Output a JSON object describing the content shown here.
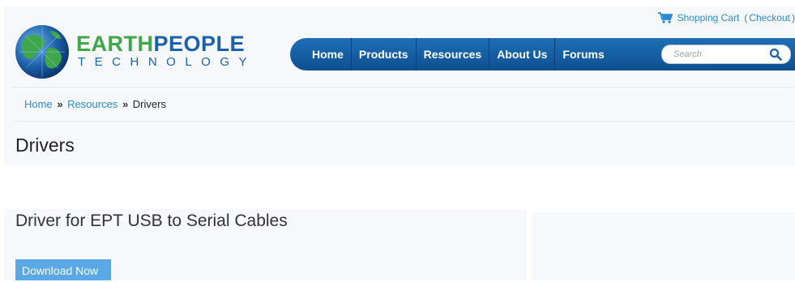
{
  "cart": {
    "shopping_cart_label": "Shopping Cart",
    "open_paren": "(",
    "checkout_label": "Checkout",
    "close_paren": ")"
  },
  "logo": {
    "earth": "EARTH",
    "people": "PEOPLE",
    "technology": "TECHNOLOGY"
  },
  "nav": {
    "items": [
      {
        "label": "Home"
      },
      {
        "label": "Products"
      },
      {
        "label": "Resources"
      },
      {
        "label": "About Us"
      },
      {
        "label": "Forums"
      }
    ]
  },
  "search": {
    "placeholder": "Search"
  },
  "breadcrumb": {
    "home": "Home",
    "resources": "Resources",
    "current": "Drivers",
    "separator": "»"
  },
  "page": {
    "title": "Drivers"
  },
  "section": {
    "title": "Driver for EPT USB to Serial Cables",
    "download_label": "Download Now"
  },
  "colors": {
    "link": "#2b8bd0",
    "nav_bg": "#1660a6",
    "logo_green": "#3fa64a",
    "logo_blue": "#1c62a8",
    "download_bg": "#5aa9e6"
  }
}
